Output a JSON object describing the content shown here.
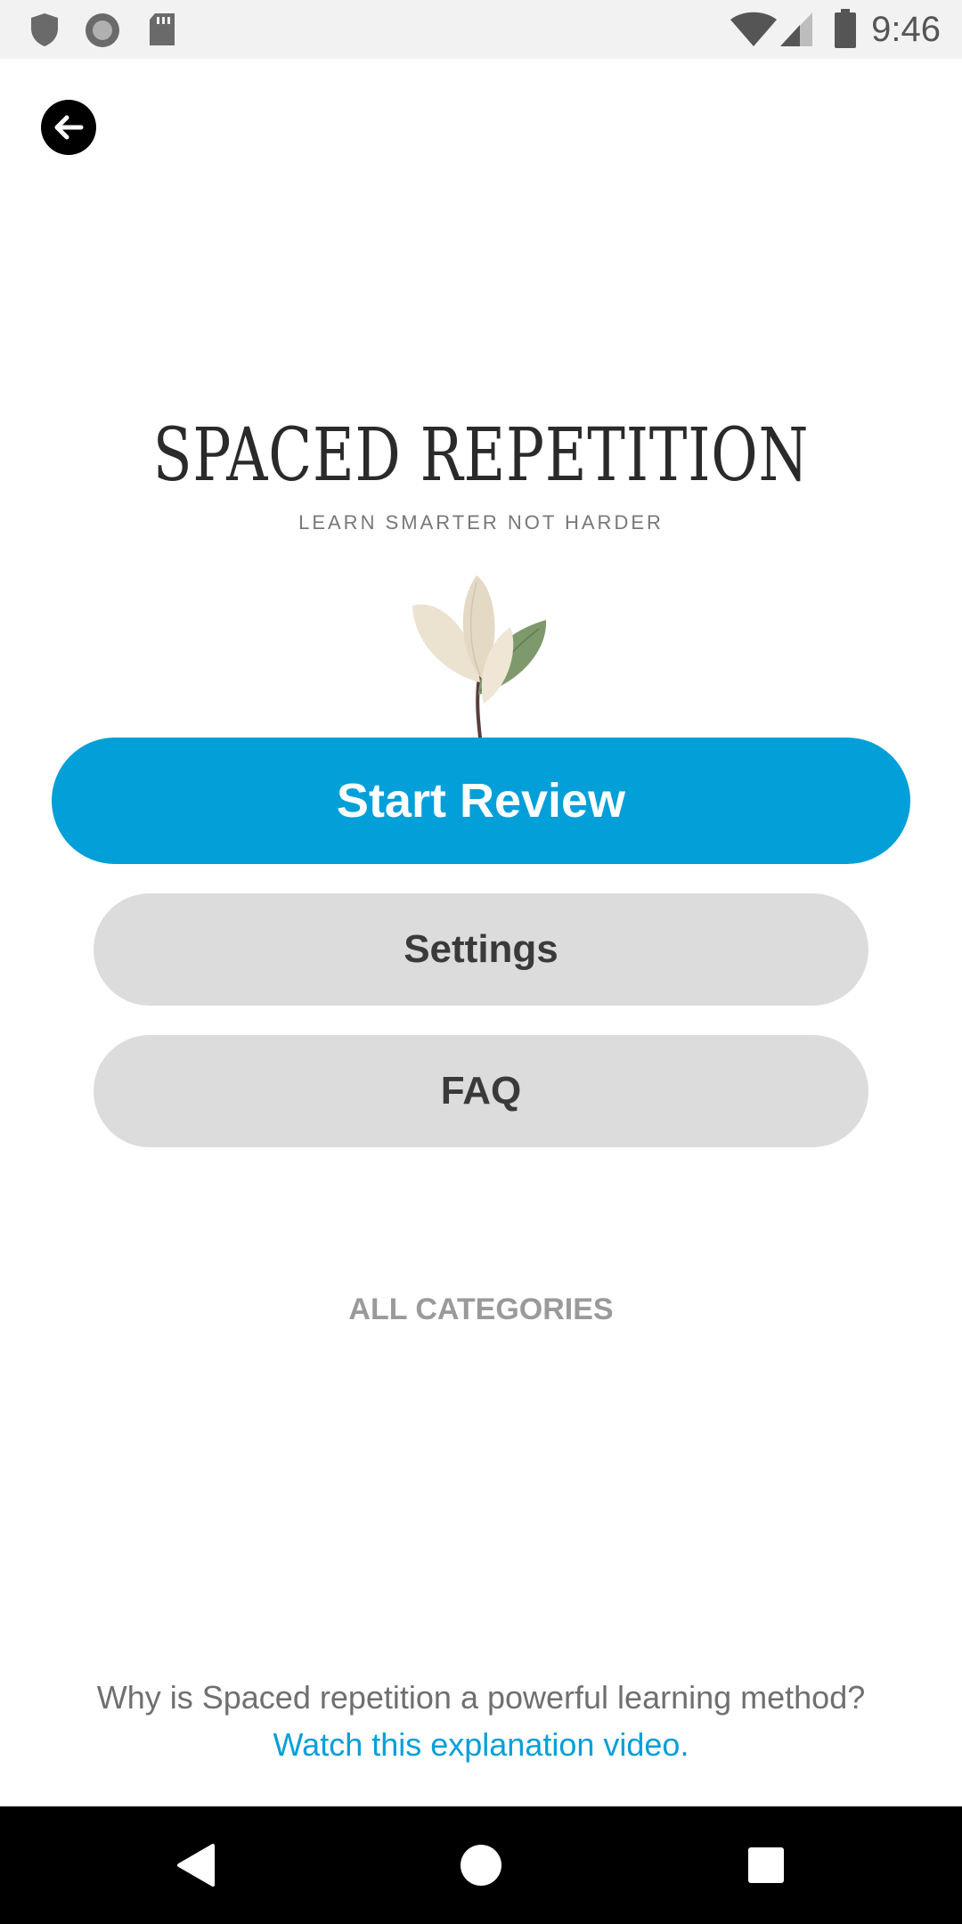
{
  "status_bar": {
    "time": "9:46",
    "left_icons": [
      "shield-icon",
      "circle-record-icon",
      "sd-card-icon"
    ],
    "right_icons": [
      "wifi-icon",
      "cell-signal-icon",
      "battery-icon"
    ]
  },
  "header": {
    "back_icon": "arrow-left-icon"
  },
  "logo": {
    "title": "SPACED REPETITION",
    "subtitle": "LEARN SMARTER NOT HARDER"
  },
  "actions": {
    "start_review": "Start Review",
    "settings": "Settings",
    "faq": "FAQ",
    "all_categories": "ALL CATEGORIES"
  },
  "footer": {
    "question": "Why is Spaced repetition a powerful learning method?",
    "link": "Watch this explanation video."
  },
  "nav_bar": {
    "back_icon": "triangle-back-icon",
    "home_icon": "circle-home-icon",
    "recents_icon": "square-recents-icon"
  },
  "colors": {
    "primary": "#029fd9",
    "secondary_button": "#dcdcdc",
    "status_bar_bg": "#f2f2f2",
    "nav_bar_bg": "#000000"
  }
}
